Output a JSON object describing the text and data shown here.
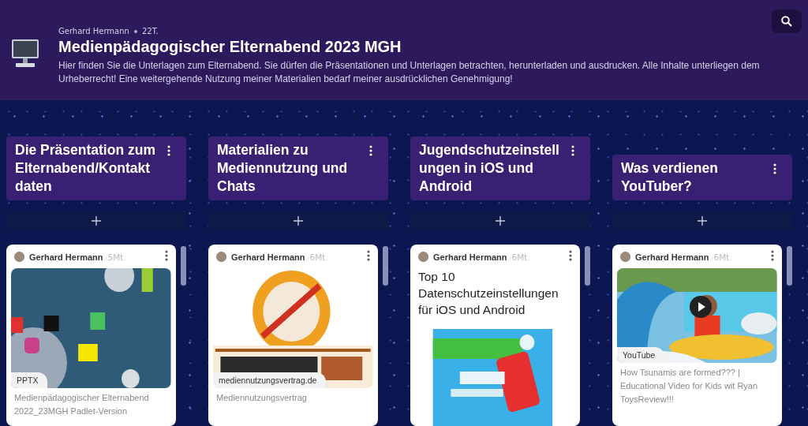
{
  "board": {
    "author": "Gerhard Hermann",
    "age": "22T.",
    "title": "Medienpädagogischer Elternabend 2023 MGH",
    "description": "Hier finden Sie die Unterlagen zum Elternabend. Sie dürfen die Präsentationen und Unterlagen betrachten, herunterladen und ausdrucken. Alle Inhalte unterliegen dem Urheberrecht! Eine weitergehende Nutzung meiner Materialien bedarf meiner ausdrücklichen Genehmigung!"
  },
  "columns": [
    {
      "title": "Die Präsentation zum Elternabend/Kontaktdaten",
      "posts": [
        {
          "kind": "file",
          "author": "Gerhard Hermann",
          "age": "5Mt.",
          "badge": "PPTX",
          "caption": "Medienpädagogischer Elternabend 2022_23MGH Padlet-Version"
        }
      ]
    },
    {
      "title": "Materialien zu Mediennutzung und Chats",
      "posts": [
        {
          "kind": "link",
          "author": "Gerhard Hermann",
          "age": "6Mt.",
          "badge": "mediennutzungsvertrag.de",
          "caption": "Mediennutzungsvertrag"
        }
      ]
    },
    {
      "title": "Jugendschutzeinstellungen in iOS und Android",
      "posts": [
        {
          "kind": "document",
          "author": "Gerhard Hermann",
          "age": "6Mt.",
          "heading": "Top 10 Datenschutzeinstellungen für iOS und Android"
        }
      ]
    },
    {
      "title": "Was verdienen YouTuber?",
      "posts": [
        {
          "kind": "video",
          "author": "Gerhard Hermann",
          "age": "6Mt.",
          "badge": "YouTube",
          "caption": "How Tsunamis are formed??? | Educational Video for Kids wit Ryan ToysReview!!!"
        }
      ]
    }
  ]
}
